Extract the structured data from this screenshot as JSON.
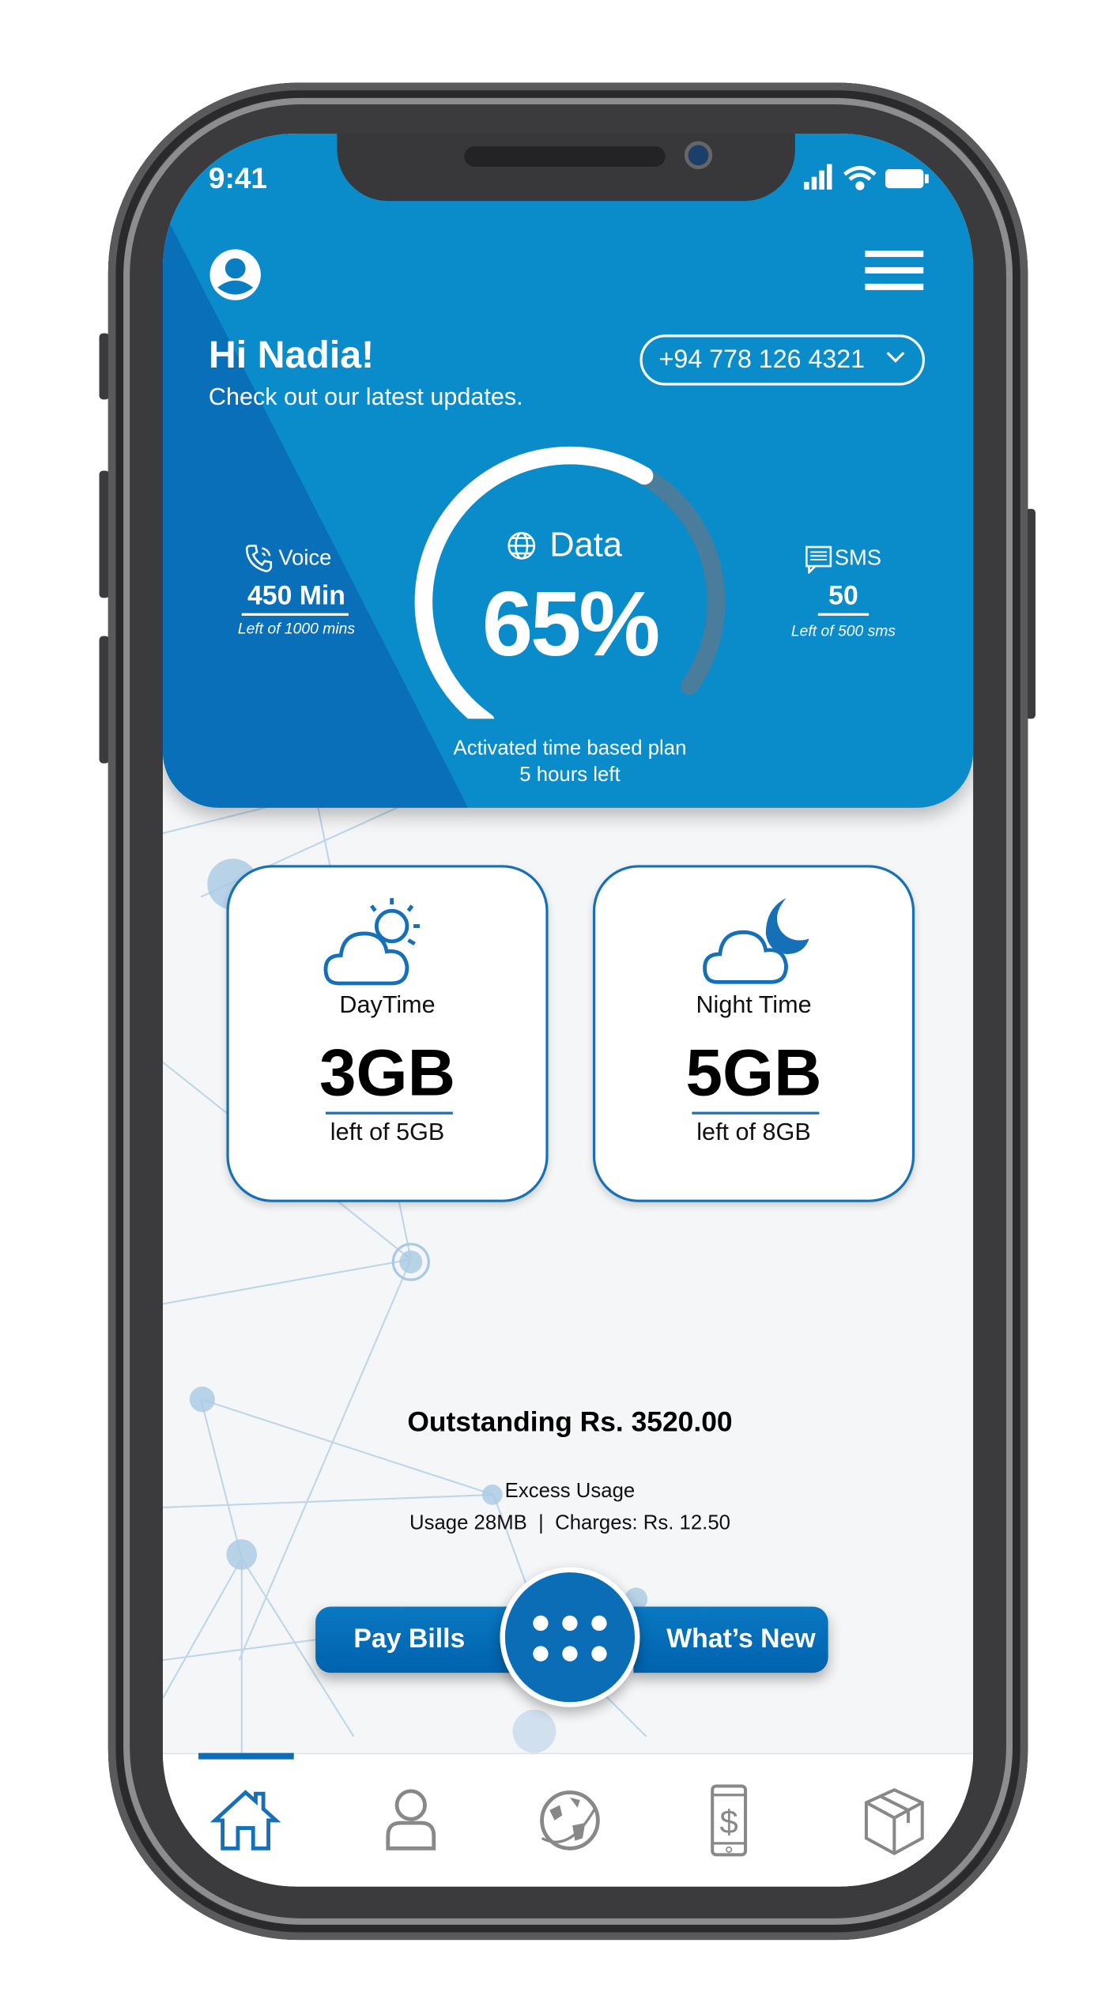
{
  "status_bar": {
    "time": "9:41"
  },
  "header": {
    "greeting": "Hi Nadia!",
    "subtitle": "Check out our latest updates.",
    "phone_number": "+94 778 126 4321"
  },
  "usage": {
    "voice": {
      "label": "Voice",
      "value": "450 Min",
      "sub": "Left of 1000 mins"
    },
    "data": {
      "label": "Data",
      "value": "65%",
      "percent": 65
    },
    "sms": {
      "label": "SMS",
      "value": "50",
      "sub": "Left of 500 sms"
    },
    "plan_line1": "Activated time based plan",
    "plan_line2": "5 hours left"
  },
  "cards": [
    {
      "label": "DayTime",
      "value": "3GB",
      "sub": "left of 5GB"
    },
    {
      "label": "Night Time",
      "value": "5GB",
      "sub": "left of 8GB"
    }
  ],
  "billing": {
    "outstanding": "Outstanding Rs. 3520.00",
    "excess_title": "Excess Usage",
    "excess_detail": "Usage 28MB  |  Charges: Rs. 12.50"
  },
  "actions": {
    "pay_bills": "Pay Bills",
    "whats_new": "What’s New"
  },
  "nav": {
    "items": [
      "home-icon",
      "profile-icon",
      "travel-globe-icon",
      "mobile-payment-icon",
      "package-icon"
    ],
    "active": "home"
  },
  "colors": {
    "primary": "#0a8ccb",
    "dark": "#0a6fb9",
    "accent": "#1670b8"
  }
}
